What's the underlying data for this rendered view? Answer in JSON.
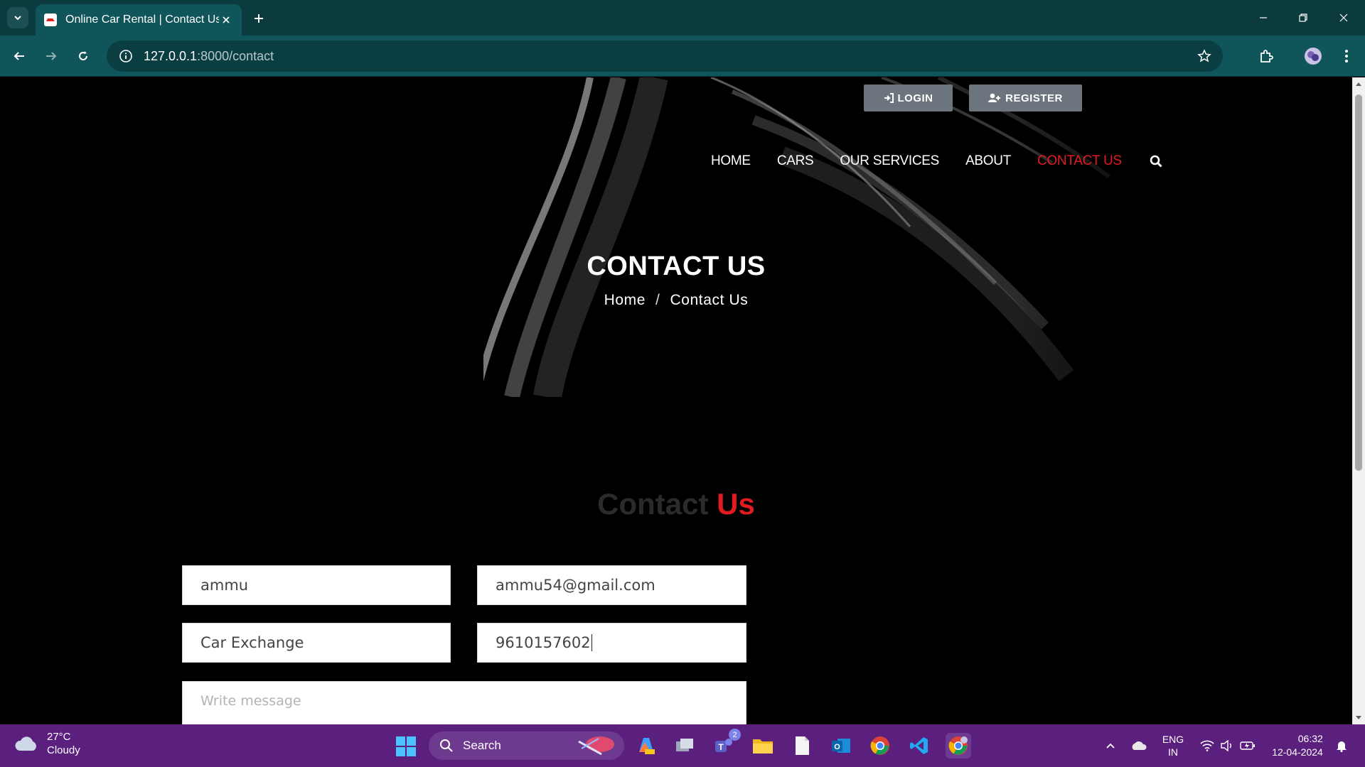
{
  "browser": {
    "tab_title": "Online Car Rental | Contact Us",
    "url_host": "127.0.0.1",
    "url_path": ":8000/contact"
  },
  "auth": {
    "login_label": "LOGIN",
    "register_label": "REGISTER"
  },
  "nav": {
    "items": [
      "HOME",
      "CARS",
      "OUR SERVICES",
      "ABOUT",
      "CONTACT US"
    ],
    "active": "CONTACT US"
  },
  "hero": {
    "title": "CONTACT US",
    "breadcrumb_home": "Home",
    "breadcrumb_sep": "/",
    "breadcrumb_current": "Contact Us"
  },
  "section": {
    "title_part1": "Contact",
    "title_part2": "Us"
  },
  "form": {
    "name_value": "ammu",
    "email_value": "ammu54@gmail.com",
    "subject_value": "Car Exchange",
    "phone_value": "9610157602",
    "message_placeholder": "Write message"
  },
  "taskbar": {
    "temperature": "27°C",
    "condition": "Cloudy",
    "search_label": "Search",
    "teams_badge": "2",
    "lang_top": "ENG",
    "lang_bottom": "IN",
    "time": "06:32",
    "date": "12-04-2024"
  },
  "colors": {
    "accent_red": "#e21a22",
    "chrome_teal": "#10555a",
    "taskbar_purple": "#5b1f7e"
  }
}
